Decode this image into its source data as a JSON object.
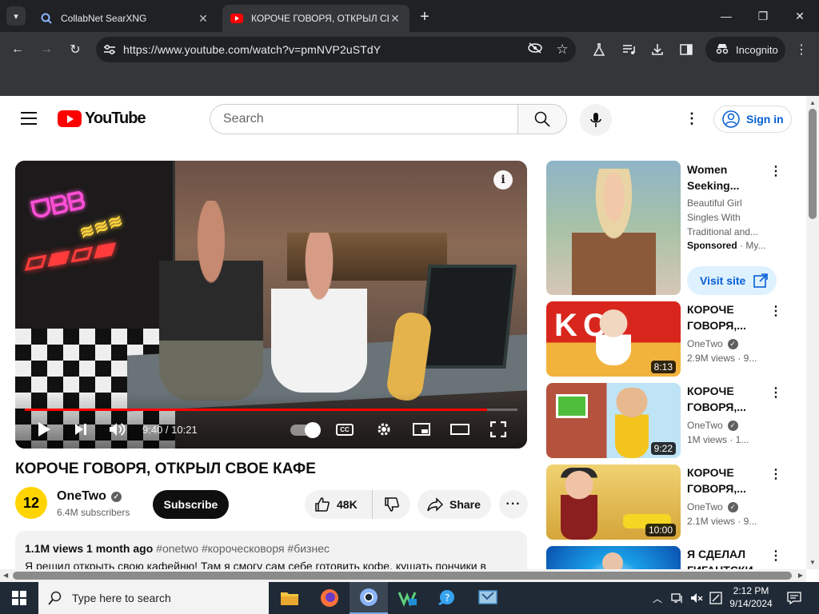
{
  "browser": {
    "tabs": [
      {
        "title": "CollabNet SearXNG",
        "active": false
      },
      {
        "title": "КОРОЧЕ ГОВОРЯ, ОТКРЫЛ СВОЕ",
        "active": true
      }
    ],
    "url": "https://www.youtube.com/watch?v=pmNVP2uSTdY",
    "incognito_label": "Incognito"
  },
  "youtube": {
    "logo_text": "YouTube",
    "search_placeholder": "Search",
    "sign_in_label": "Sign in",
    "player": {
      "time": "9:40 / 10:21",
      "progress_fraction": 0.938
    },
    "video": {
      "title": "КОРОЧЕ ГОВОРЯ, ОТКРЫЛ СВОЕ КАФЕ",
      "channel": "OneTwo",
      "channel_avatar_text": "12",
      "subscribers": "6.4M subscribers",
      "subscribe_label": "Subscribe",
      "likes": "48K",
      "share_label": "Share",
      "views": "1.1M views",
      "age": "1 month ago",
      "tags": "#onetwo #короческоворя #бизнес",
      "description": "Я решил открыть свою кафейню! Там я смогу сам себе готовить кофе, кушать пончики в"
    },
    "ad": {
      "title": "Women Seeking...",
      "description": "Beautiful Girl Singles With Traditional and...",
      "sponsored": "Sponsored",
      "advertiser": "My...",
      "visit_label": "Visit site"
    },
    "recommendations": [
      {
        "title": "КОРОЧЕ ГОВОРЯ,...",
        "channel": "OneTwo",
        "views": "2.9M views · 9...",
        "duration": "8:13"
      },
      {
        "title": "КОРОЧЕ ГОВОРЯ,...",
        "channel": "OneTwo",
        "views": "1M views · 1...",
        "duration": "9:22"
      },
      {
        "title": "КОРОЧЕ ГОВОРЯ,...",
        "channel": "OneTwo",
        "views": "2.1M views · 9...",
        "duration": "10:00"
      },
      {
        "title": "Я СДЕЛАЛ ГИГАНТСКИ...",
        "channel": "",
        "views": "",
        "duration": ""
      }
    ]
  },
  "taskbar": {
    "search_placeholder": "Type here to search",
    "time": "2:12 PM",
    "date": "9/14/2024"
  },
  "colors": {
    "youtube_red": "#ff0000",
    "progress_red": "#ff0000",
    "link_blue": "#065fd4",
    "chrome_dark": "#202124",
    "chrome_toolbar": "#35363a"
  }
}
